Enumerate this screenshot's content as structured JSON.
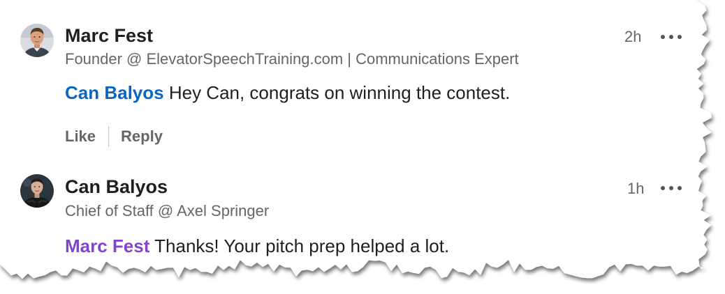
{
  "comments": [
    {
      "author": "Marc Fest",
      "headline": "Founder @ ElevatorSpeechTraining.com | Communications Expert",
      "time": "2h",
      "mention": "Can Balyos",
      "text": " Hey Can, congrats on winning the contest.",
      "mention_color": "#0a66c2",
      "actions": {
        "like": "Like",
        "reply": "Reply"
      },
      "avatar_icon": "avatar-photo-icon"
    },
    {
      "author": "Can Balyos",
      "headline": "Chief of Staff @ Axel Springer",
      "time": "1h",
      "mention": "Marc Fest",
      "text": " Thanks! Your pitch prep helped a lot.",
      "mention_color": "#8344cc",
      "avatar_icon": "avatar-photo-icon"
    }
  ],
  "theme": {
    "text_primary": "#1f1f1f",
    "text_secondary": "#666666",
    "link_blue": "#0a66c2"
  }
}
